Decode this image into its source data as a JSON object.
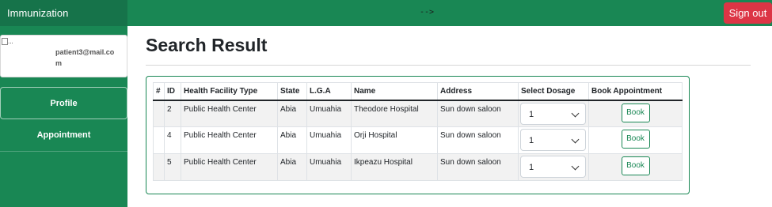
{
  "header": {
    "brand": "Immunization",
    "center_text": "-->",
    "signout_label": "Sign out"
  },
  "sidebar": {
    "user_email": "patient3@mail.com",
    "avatar_alt": "...",
    "items": [
      {
        "label": "Profile"
      },
      {
        "label": "Appointment"
      }
    ]
  },
  "main": {
    "title": "Search Result",
    "table": {
      "columns": [
        "#",
        "ID",
        "Health Facility Type",
        "State",
        "L.G.A",
        "Name",
        "Address",
        "Select Dosage",
        "Book Appointment"
      ],
      "rows": [
        {
          "num": "",
          "id": "2",
          "facility_type": "Public Health Center",
          "state": "Abia",
          "lga": "Umuahia",
          "name": "Theodore Hospital",
          "address": "Sun down saloon",
          "dosage": "1",
          "book": "Book"
        },
        {
          "num": "",
          "id": "4",
          "facility_type": "Public Health Center",
          "state": "Abia",
          "lga": "Umuahia",
          "name": "Orji Hospital",
          "address": "Sun down saloon",
          "dosage": "1",
          "book": "Book"
        },
        {
          "num": "",
          "id": "5",
          "facility_type": "Public Health Center",
          "state": "Abia",
          "lga": "Umuahia",
          "name": "Ikpeazu Hospital",
          "address": "Sun down saloon",
          "dosage": "1",
          "book": "Book"
        }
      ]
    }
  },
  "colors": {
    "primary_green": "#198754",
    "brand_green": "#16734a",
    "danger_red": "#dc3545"
  }
}
